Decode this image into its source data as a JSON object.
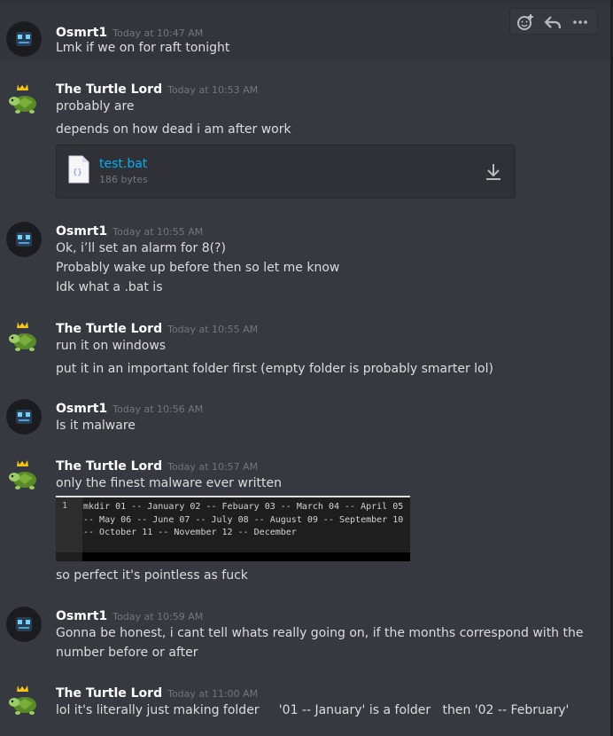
{
  "colors": {
    "background": "#36393f",
    "hover_background": "#32353b",
    "username": "#ffffff",
    "timestamp": "#72767d",
    "link": "#00b0f4"
  },
  "toolbar": {
    "buttons": [
      "add-reaction-icon",
      "reply-icon",
      "more-options-icon"
    ]
  },
  "messages": [
    {
      "author": "Osmrt1",
      "timestamp": "Today at 10:47 AM",
      "lines": [
        "Lmk if we on for raft tonight"
      ]
    },
    {
      "author": "The Turtle Lord",
      "timestamp": "Today at 10:53 AM",
      "lines": [
        "probably are",
        "depends on how dead i am after work"
      ],
      "attachment": {
        "filename": "test.bat",
        "size": "186 bytes"
      }
    },
    {
      "author": "Osmrt1",
      "timestamp": "Today at 10:55 AM",
      "lines": [
        "Ok, i’ll set an alarm for 8(?)",
        "Probably wake up before then so let me know",
        "Idk what a .bat is"
      ]
    },
    {
      "author": "The Turtle Lord",
      "timestamp": "Today at 10:55 AM",
      "lines": [
        "run it on windows",
        "put it in an important folder first  (empty folder is probably smarter lol)"
      ]
    },
    {
      "author": "Osmrt1",
      "timestamp": "Today at 10:56 AM",
      "lines": [
        "Is it malware"
      ]
    },
    {
      "author": "The Turtle Lord",
      "timestamp": "Today at 10:57 AM",
      "lines": [
        "only the finest malware ever written",
        "so perfect it's pointless as fuck"
      ],
      "code_image": {
        "line_number": "1",
        "code": "mkdir 01 -- January 02 -- Febuary 03 -- March 04 -- April 05 -- May 06 -- June 07 -- July 08 -- August 09 -- September 10 -- October 11 -- November 12 -- December"
      }
    },
    {
      "author": "Osmrt1",
      "timestamp": "Today at 10:59 AM",
      "lines": [
        "Gonna be honest, i cant tell whats really going on, if the months correspond with the",
        "number before or after"
      ]
    },
    {
      "author": "The Turtle Lord",
      "timestamp": "Today at 11:00 AM",
      "lines": [
        "lol it's literally just making folder     '01 -- January' is a folder   then '02 -- February'"
      ]
    }
  ]
}
